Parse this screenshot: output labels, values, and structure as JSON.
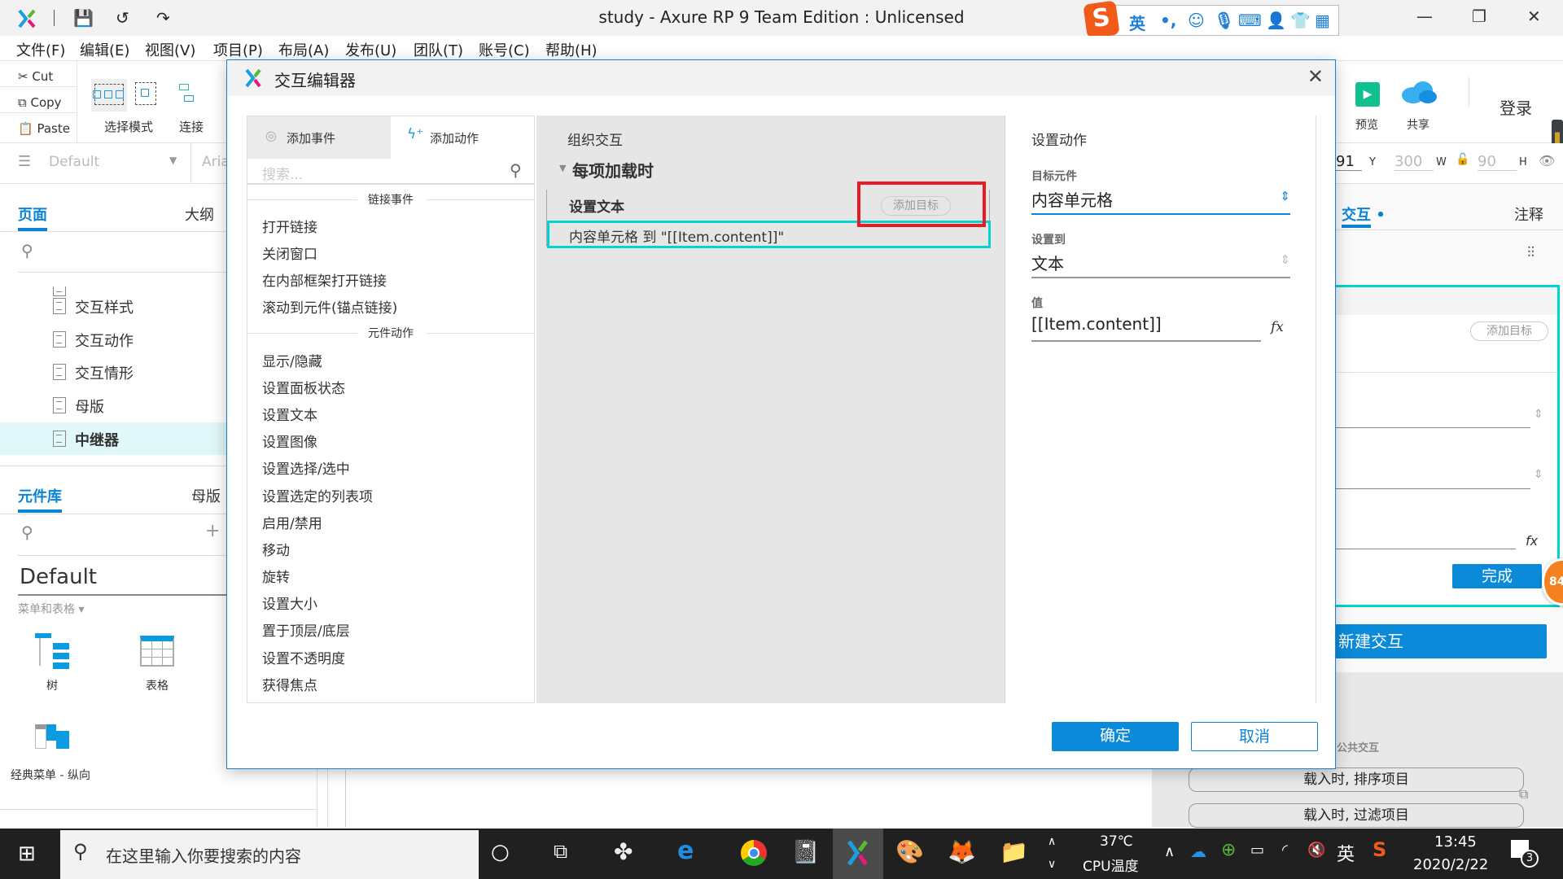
{
  "app": {
    "title": "study - Axure RP 9 Team Edition : Unlicensed",
    "quick": {
      "save": "save-icon",
      "undo": "undo-icon",
      "redo": "redo-icon"
    },
    "ime": {
      "lang": "英",
      "punct": "•,"
    },
    "window": {
      "minimize": "—",
      "maximize": "❐",
      "close": "✕"
    }
  },
  "menu": [
    "文件(F)",
    "编辑(E)",
    "视图(V)",
    "项目(P)",
    "布局(A)",
    "发布(U)",
    "团队(T)",
    "账号(C)",
    "帮助(H)"
  ],
  "toolbar": {
    "cut": "Cut",
    "copy": "Copy",
    "paste": "Paste",
    "select_mode": "选择模式",
    "connect": "连接",
    "preview": "预览",
    "share": "共享",
    "login": "登录"
  },
  "stylebar": {
    "style": "Default",
    "font": "Aria",
    "x_value": "91",
    "y_label": "Y",
    "w_value": "300",
    "w_label": "W",
    "h_value": "90",
    "h_label": "H"
  },
  "left_panel": {
    "tabs": [
      "页面",
      "大纲"
    ],
    "pages": [
      "交互样式",
      "交互动作",
      "交互情形",
      "母版",
      "中继器"
    ],
    "selected_page": "中继器",
    "library_tabs": [
      "元件库",
      "母版"
    ],
    "library_name": "Default",
    "category": "菜单和表格 ▾",
    "widgets": [
      "树",
      "表格",
      "经典菜单 - 纵向"
    ]
  },
  "right_panel": {
    "tabs": [
      "交互",
      "注释"
    ],
    "add_target": "添加目标",
    "done": "完成",
    "new_interaction": "新建交互",
    "common_label": "公共交互",
    "common": [
      "载入时, 排序项目",
      "载入时, 过滤项目"
    ],
    "badge": "84"
  },
  "dialog": {
    "title": "交互编辑器",
    "tabs": {
      "add_event": "添加事件",
      "add_action": "添加动作"
    },
    "search_placeholder": "搜索...",
    "sections": [
      {
        "header": "链接事件",
        "items": [
          "打开链接",
          "关闭窗口",
          "在内部框架打开链接",
          "滚动到元件(锚点链接)"
        ]
      },
      {
        "header": "元件动作",
        "items": [
          "显示/隐藏",
          "设置面板状态",
          "设置文本",
          "设置图像",
          "设置选择/选中",
          "设置选定的列表项",
          "启用/禁用",
          "移动",
          "旋转",
          "设置大小",
          "置于顶层/底层",
          "设置不透明度",
          "获得焦点"
        ]
      }
    ],
    "middle": {
      "header": "组织交互",
      "event": "每项加载时",
      "action": "设置文本",
      "add_target": "添加目标",
      "target_line": "内容单元格 到 \"[[Item.content]]\""
    },
    "right": {
      "header": "设置动作",
      "target_label": "目标元件",
      "target_value": "内容单元格",
      "set_to_label": "设置到",
      "set_to_value": "文本",
      "value_label": "值",
      "value": "[[Item.content]]",
      "fx": "fx"
    },
    "ok": "确定",
    "cancel": "取消"
  },
  "taskbar": {
    "search_placeholder": "在这里输入你要搜索的内容",
    "cpu_temp": "37℃",
    "cpu_label": "CPU温度",
    "ime": "英",
    "time": "13:45",
    "date": "2020/2/22",
    "notifications": "3"
  },
  "colors": {
    "accent": "#0a84d6",
    "highlight_red": "#e81c24",
    "selection_cyan": "#00d5d5",
    "selected_page_bg": "#e0f8f9"
  }
}
